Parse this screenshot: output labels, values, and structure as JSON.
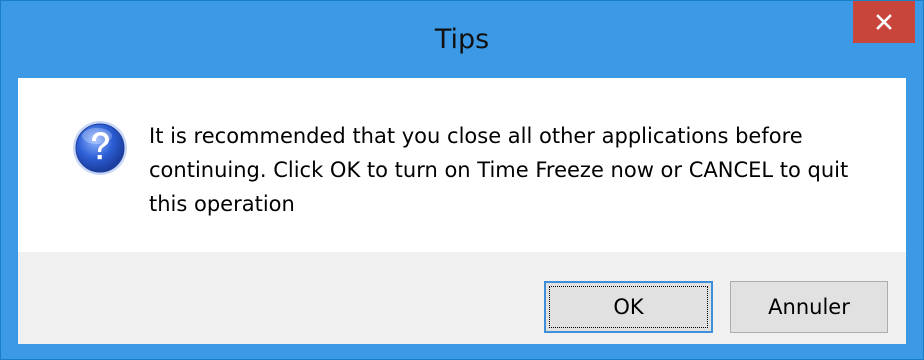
{
  "window": {
    "title": "Tips",
    "close_icon": "close-icon",
    "close_button_color": "#c7453b",
    "titlebar_color": "#3c99e6"
  },
  "dialog": {
    "icon": "question-icon",
    "message": "It is recommended that you close all other applications before continuing. Click OK to turn on Time Freeze now or CANCEL to quit this operation"
  },
  "buttons": {
    "ok_label": "OK",
    "cancel_label": "Annuler"
  }
}
